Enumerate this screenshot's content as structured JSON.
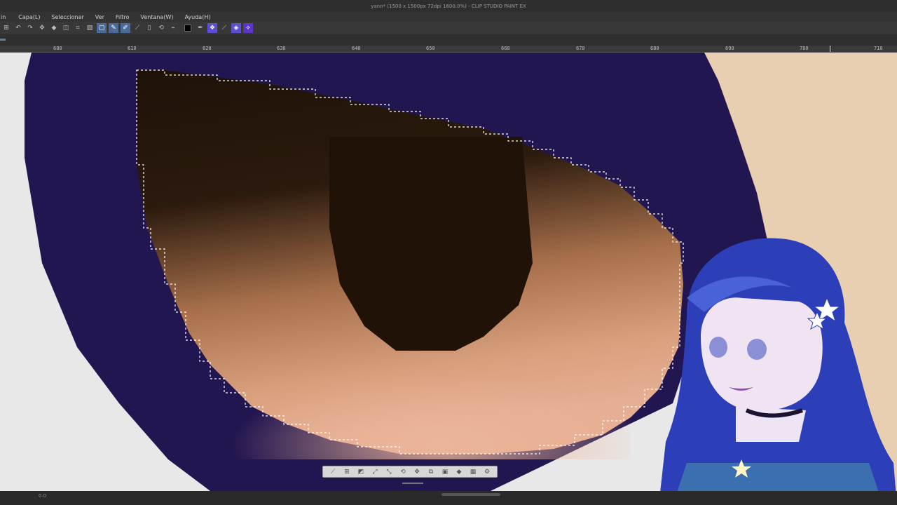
{
  "window": {
    "title": "yann* (1500 x 1500px 72dpi 1600.0%) - CLIP STUDIO PAINT EX"
  },
  "menu": {
    "items": [
      "in",
      "Capa(L)",
      "Seleccionar",
      "Ver",
      "Filtro",
      "Ventana(W)",
      "Ayuda(H)"
    ]
  },
  "toolbar": {
    "icons": [
      "new-icon",
      "undo-icon",
      "redo-icon",
      "transform-icon",
      "fill-icon",
      "select-icon",
      "lasso-icon",
      "rect-select-icon",
      "pen-icon",
      "brush-icon",
      "ruler-icon",
      "eraser-icon",
      "eyedropper-icon",
      "color-swatch",
      "color-picker-icon",
      "pen-pressure-icon",
      "gradient-icon",
      "magic-icon"
    ]
  },
  "ruler": {
    "labels": [
      "600",
      "610",
      "620",
      "630",
      "640",
      "650",
      "660",
      "670",
      "680",
      "690",
      "700",
      "710"
    ]
  },
  "status": {
    "zoom": "0.0"
  },
  "colors": {
    "background_navy": "#221650",
    "skin_peach": "#e7cdb0",
    "eye_dark": "#2a180c",
    "pale_gray": "#e8e8e8",
    "selection": "#ffffff",
    "hair_blue": "#2d3fb8"
  },
  "bottom_tools": {
    "icons": [
      "deselect-icon",
      "select-all-icon",
      "invert-icon",
      "expand-icon",
      "shrink-icon",
      "lasso-icon",
      "move-icon",
      "copy-icon",
      "paste-icon",
      "fill-icon",
      "pattern-icon",
      "settings-icon"
    ]
  }
}
